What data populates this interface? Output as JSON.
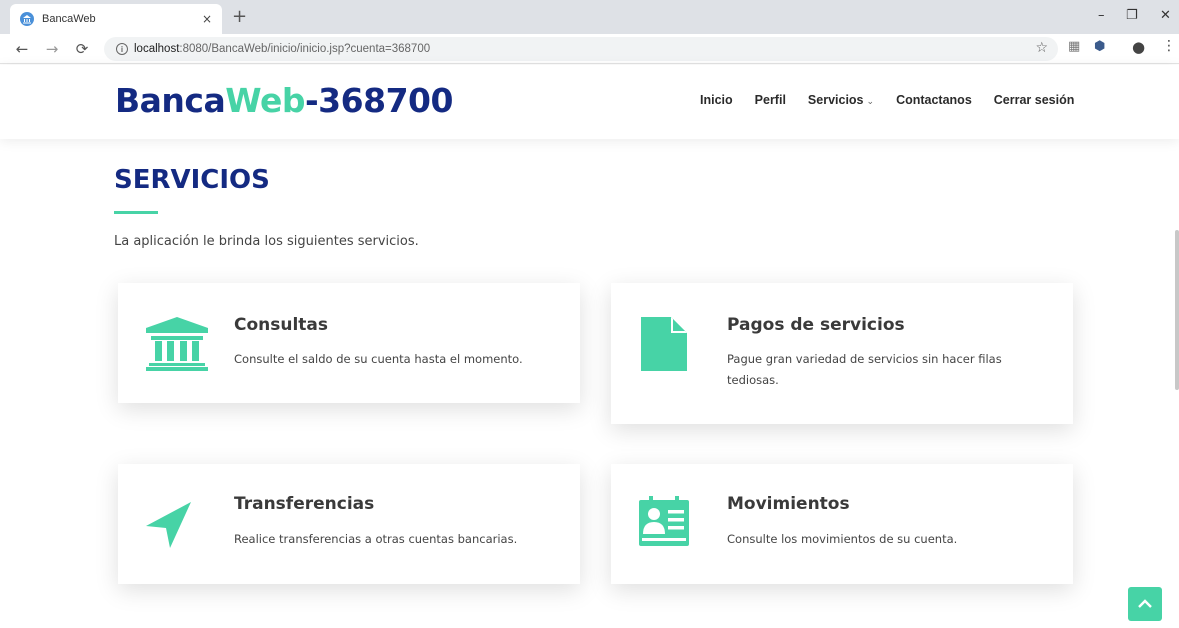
{
  "browser": {
    "tab_title": "BancaWeb",
    "tab_close": "×",
    "new_tab": "+",
    "url_host": "localhost",
    "url_rest": ":8080/BancaWeb/inicio/inicio.jsp?cuenta=368700",
    "controls": {
      "minimize": "–",
      "restore": "❐",
      "close": "✕"
    }
  },
  "header": {
    "brand_part1": "Banca",
    "brand_part2": "Web",
    "brand_part3": "-368700",
    "nav": [
      "Inicio",
      "Perfil",
      "Servicios",
      "Contactanos",
      "Cerrar sesión"
    ]
  },
  "section": {
    "title": "SERVICIOS",
    "description": "La aplicación le brinda los siguientes servicios."
  },
  "cards": [
    {
      "title": "Consultas",
      "text": "Consulte el saldo de su cuenta hasta el momento.",
      "icon": "bank-icon"
    },
    {
      "title": "Pagos de servicios",
      "text": "Pague gran variedad de servicios sin hacer filas tediosas.",
      "icon": "document-icon"
    },
    {
      "title": "Transferencias",
      "text": "Realice transferencias a otras cuentas bancarias.",
      "icon": "send-icon"
    },
    {
      "title": "Movimientos",
      "text": "Consulte los movimientos de su cuenta.",
      "icon": "id-card-icon"
    }
  ],
  "colors": {
    "brand_blue": "#142a82",
    "accent_green": "#47d3a6"
  }
}
